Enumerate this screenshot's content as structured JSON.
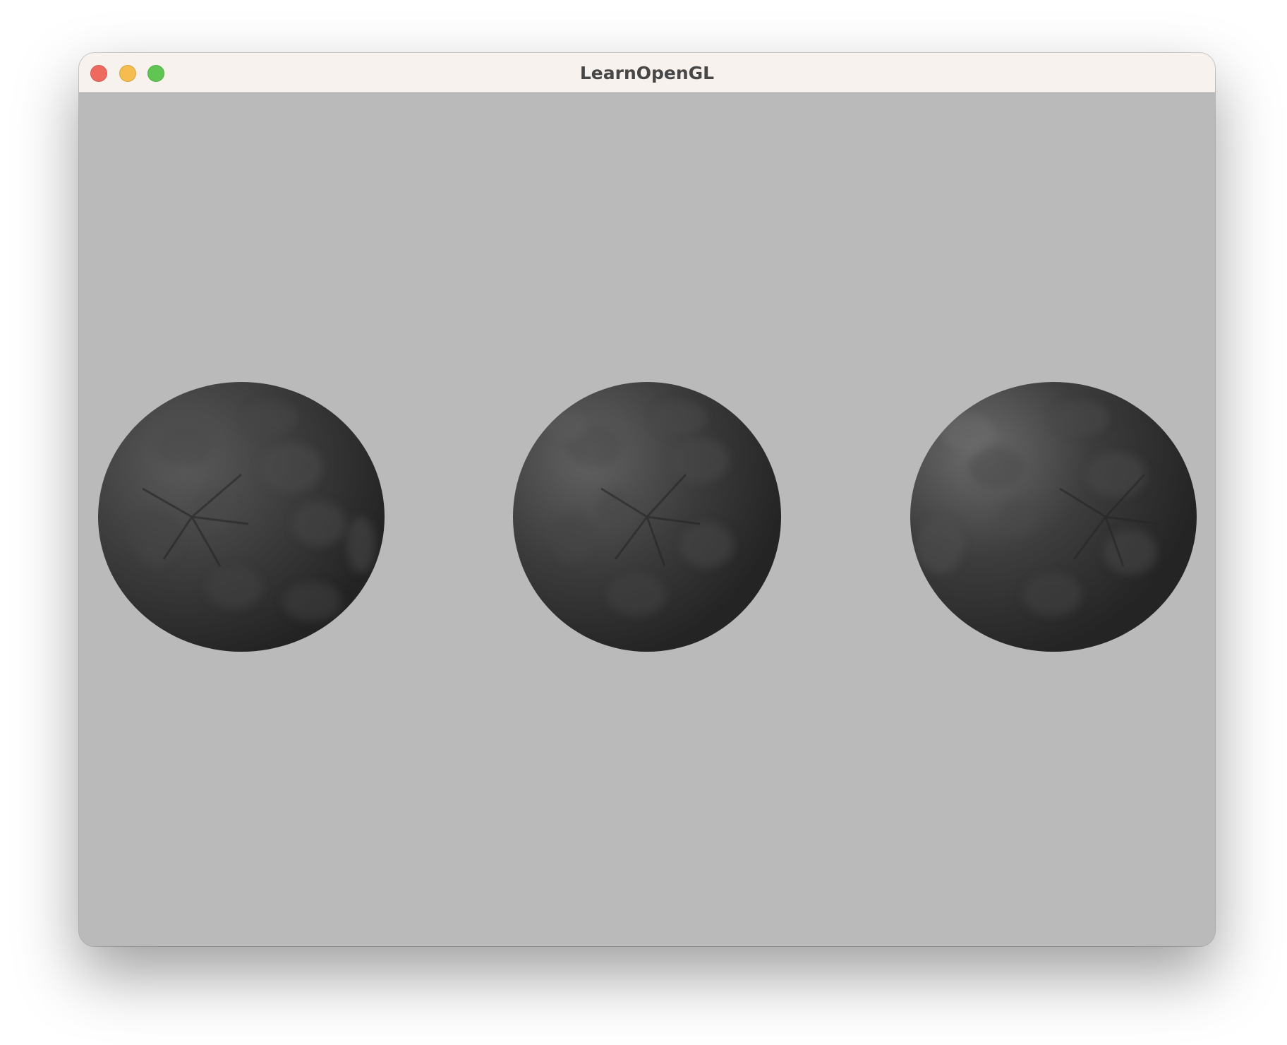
{
  "window": {
    "title": "LearnOpenGL"
  },
  "traffic_lights": {
    "close": "close-button",
    "minimize": "minimize-button",
    "maximize": "maximize-button"
  },
  "scene": {
    "background_color": "#bababa",
    "sphere_count": 3,
    "sphere_color": "#3a3a3a"
  }
}
